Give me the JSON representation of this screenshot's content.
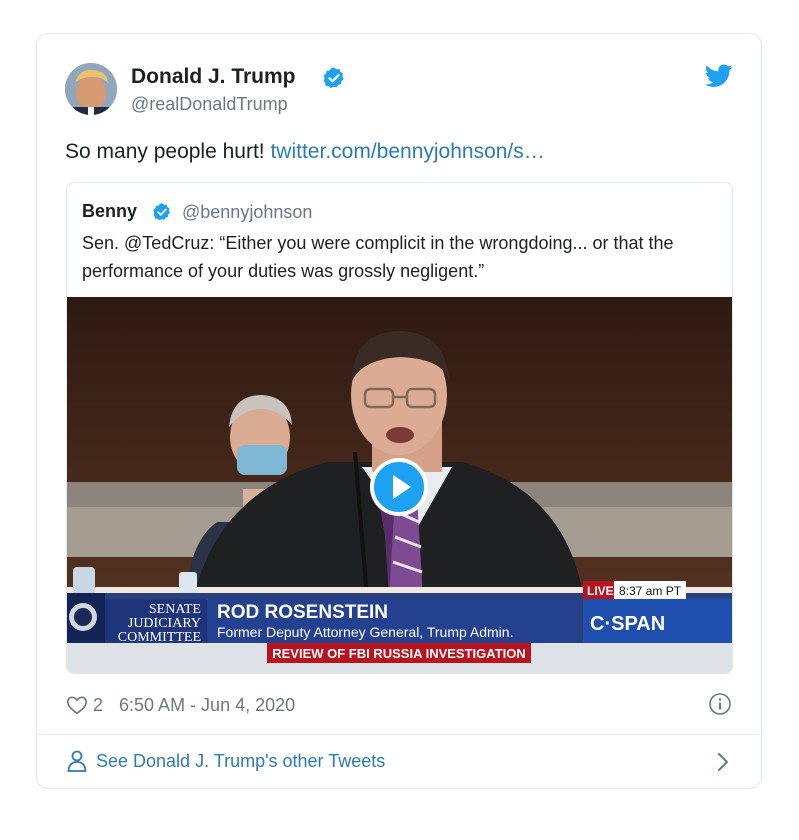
{
  "author": {
    "name": "Donald J. Trump",
    "handle": "@realDonaldTrump"
  },
  "tweet": {
    "text": "So many people hurt! ",
    "link_text": "twitter.com/bennyjohnson/s…"
  },
  "quoted": {
    "name": "Benny",
    "handle": "@bennyjohnson",
    "text": "Sen. @TedCruz: “Either you were complicit in the wrongdoing... or that the performance of your duties was grossly negligent.”",
    "video": {
      "committee": [
        "SENATE",
        "JUDICIARY",
        "COMMITTEE"
      ],
      "person_name": "ROD ROSENSTEIN",
      "person_title": "Former Deputy Attorney General, Trump Admin.",
      "topic": "REVIEW OF FBI RUSSIA INVESTIGATION",
      "live_label": "LIVE",
      "time": "8:37 am PT",
      "network": "C·SPAN"
    }
  },
  "meta": {
    "likes": "2",
    "timestamp": "6:50 AM - Jun 4, 2020"
  },
  "footer": {
    "more_tweets": "See Donald J. Trump's other Tweets"
  },
  "icons": {
    "verified": "verified-badge-icon",
    "bird": "twitter-bird-icon",
    "heart": "heart-icon",
    "info": "info-icon",
    "person": "person-icon",
    "chevron": "chevron-right-icon",
    "play": "play-icon"
  },
  "colors": {
    "link": "#2b7bb9",
    "brand": "#1da1f2",
    "muted": "#697882",
    "border": "#e1e8ed",
    "cspan_blue": "#1f3f86",
    "cspan_red": "#b8141f"
  }
}
